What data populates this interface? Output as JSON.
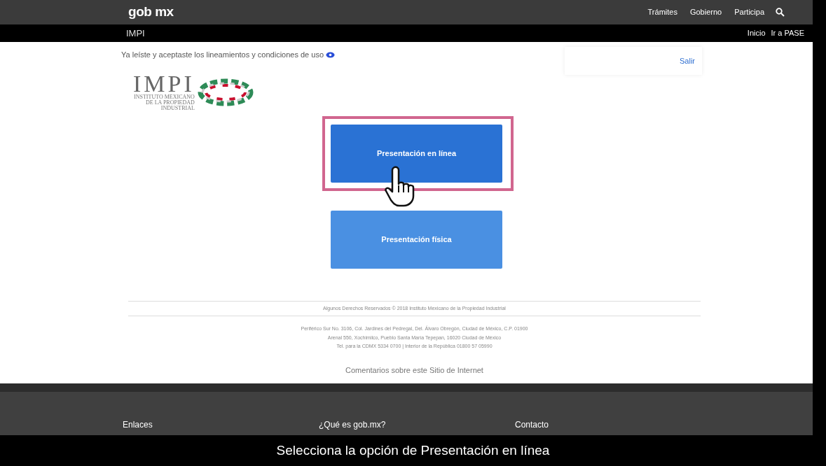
{
  "header": {
    "brand": "gob mx",
    "nav": [
      "Trámites",
      "Gobierno",
      "Participa"
    ]
  },
  "subbar": {
    "title": "IMPI",
    "links": [
      "Inicio",
      "Ir a PASE"
    ]
  },
  "notice": "Ya leíste y aceptaste los lineamientos y condiciones de uso",
  "user_panel": {
    "logout": "Salir"
  },
  "logo": {
    "name": "IMPI",
    "subtitle": [
      "INSTITUTO MEXICANO",
      "DE LA PROPIEDAD",
      "INDUSTRIAL"
    ]
  },
  "options": [
    {
      "label": "Presentación en línea",
      "highlighted": true
    },
    {
      "label": "Presentación física",
      "highlighted": false
    }
  ],
  "copyright": "Algunos Derechos Reservados © 2018 Instituto Mexicano de la Propiedad Industrial",
  "address": [
    "Periférico Sur No. 3106, Col. Jardines del Pedregal, Del. Álvaro Obregón, Ciudad de México, C.P. 01900",
    "Arenal 550, Xochimilco, Pueblo Santa María Tepepan, 16020 Ciudad de México",
    "Tel. para la CDMX 5334 0700 | Interior de la República 01800 57 05990"
  ],
  "feedback_link": "Comentarios sobre este Sitio de Internet",
  "footer_links": [
    "Enlaces",
    "¿Qué es gob.mx?",
    "Contacto"
  ],
  "caption": "Selecciona la opción de Presentación en línea"
}
